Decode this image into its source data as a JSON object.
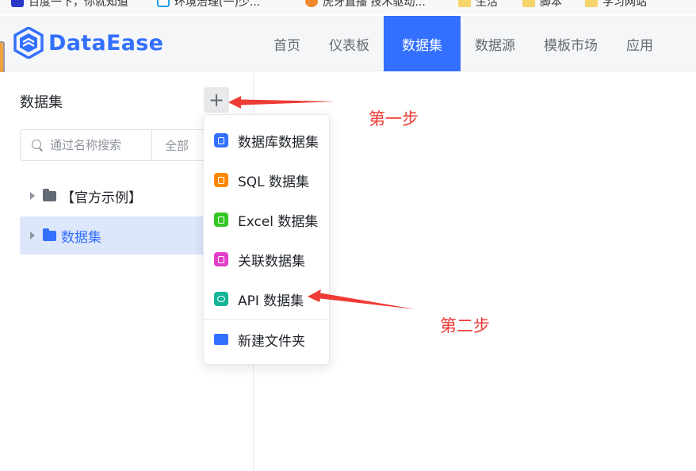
{
  "bookmarks": [
    {
      "label": "百度一下，你就知道",
      "icon": "baidu-icon"
    },
    {
      "label": "环境治理(一)少...",
      "icon": "link-icon"
    },
    {
      "label": "虎牙直播 技术驱动...",
      "icon": "live-icon"
    },
    {
      "label": "生活",
      "icon": "folder-icon"
    },
    {
      "label": "脚本",
      "icon": "folder-icon"
    },
    {
      "label": "学习网站",
      "icon": "folder-icon"
    }
  ],
  "header": {
    "logo_text": "DataEase",
    "nav": [
      {
        "label": "首页",
        "active": false
      },
      {
        "label": "仪表板",
        "active": false
      },
      {
        "label": "数据集",
        "active": true
      },
      {
        "label": "数据源",
        "active": false
      },
      {
        "label": "模板市场",
        "active": false
      },
      {
        "label": "应用",
        "active": false
      }
    ]
  },
  "sidebar": {
    "title": "数据集",
    "add_button": "+",
    "search": {
      "placeholder": "通过名称搜索",
      "value": ""
    },
    "filter": "全部",
    "tree": [
      {
        "label": "【官方示例】",
        "selected": false
      },
      {
        "label": "数据集",
        "selected": true
      }
    ]
  },
  "menu": {
    "items": [
      {
        "label": "数据库数据集",
        "icon": "database-icon"
      },
      {
        "label": "SQL 数据集",
        "icon": "sql-file-icon"
      },
      {
        "label": "Excel 数据集",
        "icon": "excel-file-icon"
      },
      {
        "label": "关联数据集",
        "icon": "union-icon"
      },
      {
        "label": "API 数据集",
        "icon": "api-cloud-icon"
      },
      {
        "label": "新建文件夹",
        "icon": "folder-icon"
      }
    ]
  },
  "annotations": {
    "step1": "第一步",
    "step2": "第二步",
    "color": "#ee3b35"
  },
  "colors": {
    "brand": "#3370ff",
    "selected_bg": "#dde7fb"
  }
}
